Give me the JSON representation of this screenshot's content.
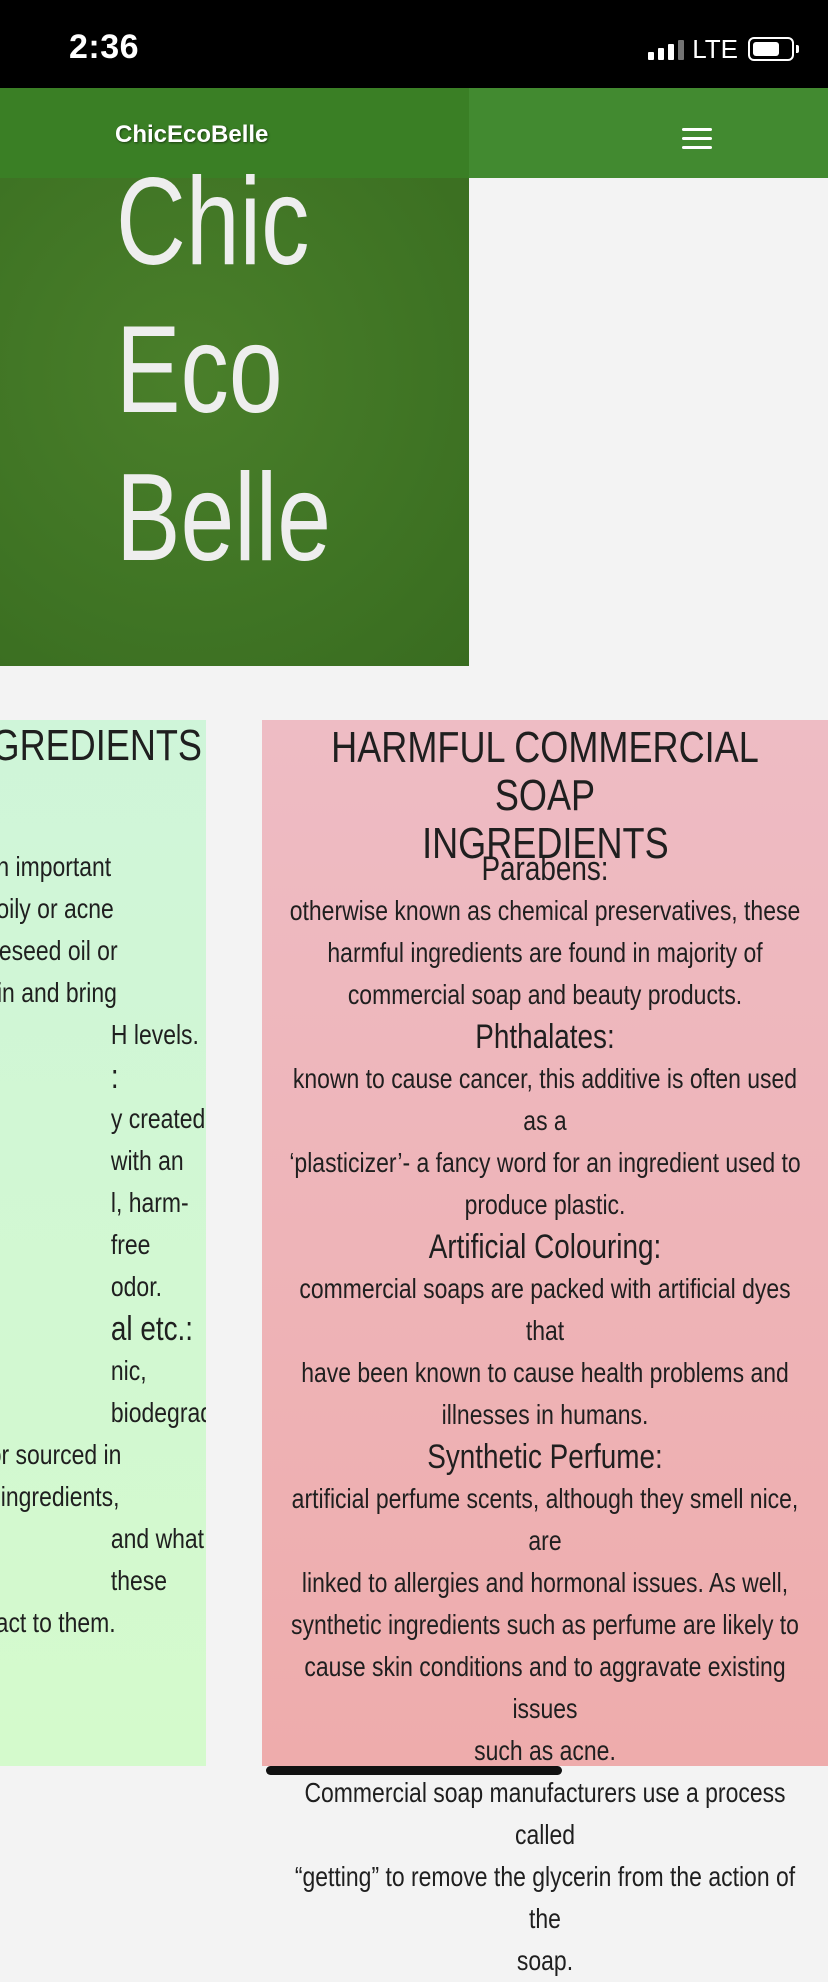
{
  "status_bar": {
    "time": "2:36",
    "network": "LTE"
  },
  "navbar": {
    "brand": "ChicEcoBelle"
  },
  "hero": {
    "lines": [
      "Chic",
      "Eco",
      "Belle"
    ]
  },
  "good_card": {
    "title": "P INGREDIENTS",
    "lines": [
      "tually an important",
      "u have oily or acne",
      "oil, grapeseed oil or",
      "urize skin and bring",
      "H levels.",
      ":",
      "y created with an",
      "l, harm-free odor.",
      "al etc.:",
      "nic, biodegradable",
      "duced, or sourced in",
      "hemical ingredients,",
      "and what these",
      "y will react to them."
    ]
  },
  "harmful_card": {
    "title_line1": "HARMFUL COMMERCIAL SOAP",
    "title_line2": "INGREDIENTS",
    "sections": [
      {
        "heading": "Parabens:",
        "lines": [
          "otherwise known as chemical preservatives, these",
          "harmful ingredients are found in majority of",
          "commercial soap and beauty products."
        ]
      },
      {
        "heading": "Phthalates:",
        "lines": [
          "known to cause cancer, this additive is often used as a",
          "‘plasticizer’- a fancy word for an ingredient used to",
          "produce plastic."
        ]
      },
      {
        "heading": "Artificial Colouring:",
        "lines": [
          "commercial soaps are packed with artificial dyes that",
          "have been known to cause health problems and",
          "illnesses in humans."
        ]
      },
      {
        "heading": "Synthetic Perfume:",
        "lines": [
          "artificial perfume scents, although they smell nice, are",
          "linked to allergies and hormonal issues. As well,",
          "synthetic ingredients such as perfume are likely to",
          "cause skin conditions and to aggravate existing issues",
          "such as acne."
        ]
      }
    ],
    "closing_lines": [
      "Commercial soap manufacturers use a process called",
      "“getting” to remove the glycerin from the action of the",
      "soap."
    ]
  }
}
